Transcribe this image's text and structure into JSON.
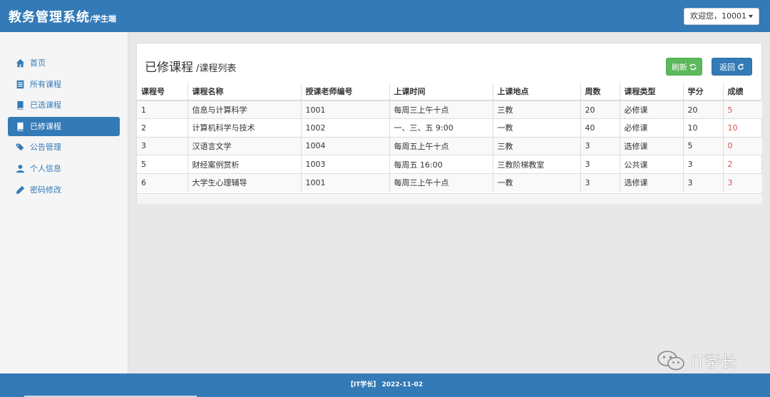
{
  "header": {
    "brand": "教务管理系统",
    "brand_sub": "/学生端",
    "user_label": "欢迎您，10001"
  },
  "sidebar": {
    "items": [
      {
        "label": "首页",
        "icon": "home-icon",
        "active": false
      },
      {
        "label": "所有课程",
        "icon": "list-icon",
        "active": false
      },
      {
        "label": "已选课程",
        "icon": "book-icon",
        "active": false
      },
      {
        "label": "已修课程",
        "icon": "book-icon",
        "active": true
      },
      {
        "label": "公告管理",
        "icon": "tags-icon",
        "active": false
      },
      {
        "label": "个人信息",
        "icon": "user-icon",
        "active": false
      },
      {
        "label": "密码修改",
        "icon": "pencil-icon",
        "active": false
      }
    ]
  },
  "main": {
    "title": "已修课程",
    "subtitle": "/课程列表",
    "refresh_label": "刷新",
    "back_label": "返回",
    "table": {
      "columns": [
        "课程号",
        "课程名称",
        "授课老师编号",
        "上课时间",
        "上课地点",
        "周数",
        "课程类型",
        "学分",
        "成绩"
      ],
      "rows": [
        [
          "1",
          "信息与计算科学",
          "1001",
          "每周三上午十点",
          "三教",
          "20",
          "必修课",
          "20",
          "5"
        ],
        [
          "2",
          "计算机科学与技术",
          "1002",
          "一、三、五 9:00",
          "一教",
          "40",
          "必修课",
          "10",
          "10"
        ],
        [
          "3",
          "汉语言文学",
          "1004",
          "每周五上午十点",
          "三教",
          "3",
          "选修课",
          "5",
          "0"
        ],
        [
          "5",
          "财经案例赏析",
          "1003",
          "每周五 16:00",
          "三教阶梯教室",
          "3",
          "公共课",
          "3",
          "2"
        ],
        [
          "6",
          "大学生心理辅导",
          "1001",
          "每周三上午十点",
          "一教",
          "3",
          "选修课",
          "3",
          "3"
        ]
      ]
    }
  },
  "footer": {
    "text": "【IT学长】 2022-11-02"
  },
  "watermark": {
    "text": "IT学长",
    "icon": "wechat-icon"
  },
  "colors": {
    "primary": "#337ab7",
    "success": "#5cb85c",
    "score": "#d9534f"
  }
}
